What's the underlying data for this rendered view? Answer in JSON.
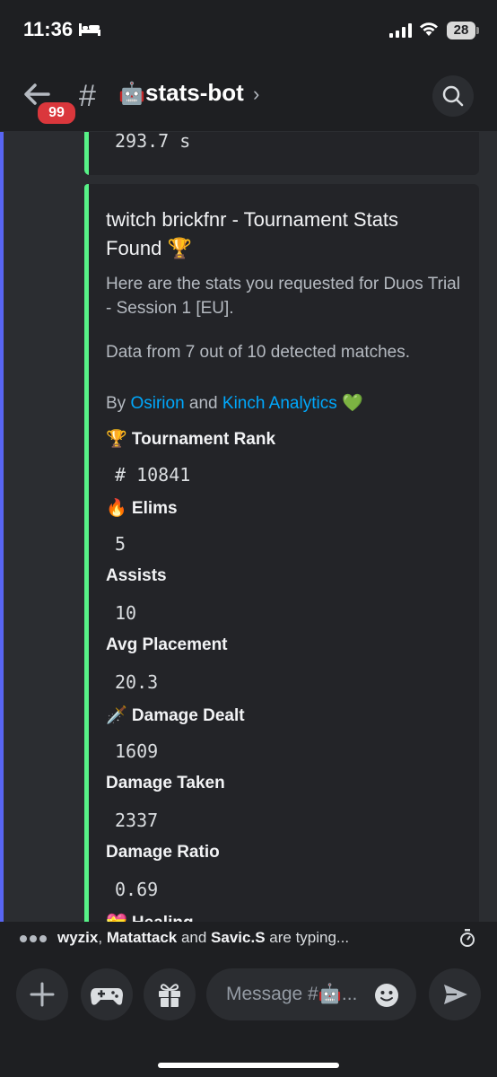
{
  "status": {
    "time": "11:36",
    "battery": "28"
  },
  "header": {
    "unread_badge": "99",
    "channel_emoji": "🤖",
    "channel_name": "stats-bot",
    "chevron": "›"
  },
  "previous_embed": {
    "text": "293.7 s"
  },
  "embed": {
    "title": "twitch brickfnr - Tournament Stats Found 🏆",
    "description": "Here are the stats you requested for Duos Trial - Session 1 [EU].",
    "data_note": "Data from 7 out of 10 detected matches.",
    "credit": {
      "prefix": "By ",
      "author1": "Osirion",
      "joiner": " and ",
      "author2": "Kinch Analytics",
      "heart": " 💚"
    },
    "fields": [
      {
        "name": "🏆 Tournament Rank",
        "value": "# 10841"
      },
      {
        "name": "🔥 Elims",
        "value": "5"
      },
      {
        "name": "Assists",
        "value": "10"
      },
      {
        "name": "Avg Placement",
        "value": "20.3"
      },
      {
        "name": "🗡️ Damage Dealt",
        "value": "1609"
      },
      {
        "name": "Damage Taken",
        "value": "2337"
      },
      {
        "name": "Damage Ratio",
        "value": "0.69"
      },
      {
        "name": "💝 Healing",
        "value": ""
      }
    ]
  },
  "typing": {
    "users_a": "wyzix",
    "sep1": ", ",
    "users_b": "Matattack",
    "sep2": " and ",
    "users_c": "Savic.S",
    "suffix": " are typing..."
  },
  "composer": {
    "placeholder": "Message #🤖..."
  },
  "colors": {
    "accent": "#5865f2",
    "embed_bar": "#57f287",
    "link": "#00a8fc",
    "badge": "#da373c"
  }
}
